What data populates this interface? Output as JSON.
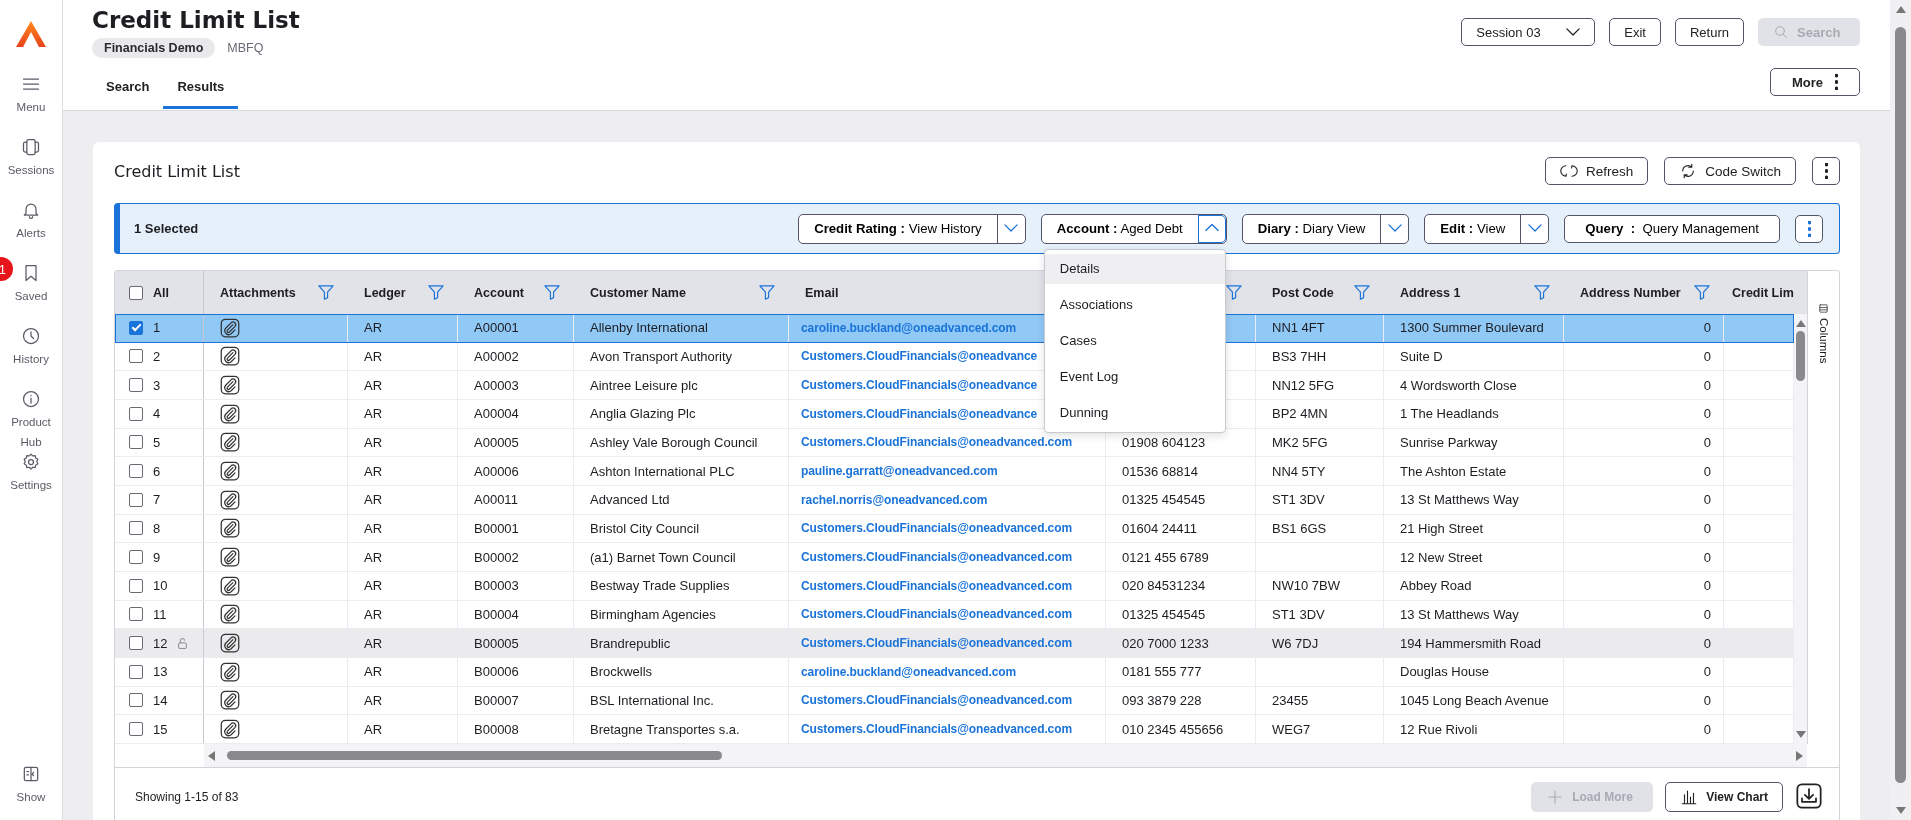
{
  "sidebar": {
    "items": [
      {
        "label": "Menu",
        "kind": "menu"
      },
      {
        "label": "Sessions",
        "kind": "sessions"
      },
      {
        "label": "Alerts",
        "kind": "alerts"
      },
      {
        "label": "Saved",
        "kind": "saved",
        "badge": "1"
      },
      {
        "label": "History",
        "kind": "history"
      },
      {
        "label": "Product Hub",
        "kind": "info"
      },
      {
        "label": "Settings",
        "kind": "settings"
      }
    ],
    "bottom": {
      "label": "Show",
      "kind": "show"
    }
  },
  "header": {
    "title": "Credit Limit List",
    "chip": "Financials Demo",
    "code": "MBFQ",
    "tabs": [
      {
        "label": "Search",
        "selected": false
      },
      {
        "label": "Results",
        "selected": true
      }
    ],
    "session": "Session 03",
    "buttons": [
      "Exit",
      "Return"
    ],
    "search": {
      "label": "Search",
      "disabled": true
    },
    "more": "More"
  },
  "card": {
    "title": "Credit Limit List",
    "actions": [
      {
        "label": "Refresh",
        "kind": "refresh"
      },
      {
        "label": "Code Switch",
        "kind": "switch"
      }
    ]
  },
  "toolbar": {
    "selection": "1 Selected",
    "actions": [
      {
        "kind": "split",
        "text": "**Credit Rating :** View History",
        "expanded": false
      },
      {
        "kind": "split",
        "text": "**Account :** Aged Debt",
        "expanded": true
      },
      {
        "kind": "split",
        "text": "**Diary :** Diary View",
        "expanded": false
      },
      {
        "kind": "split",
        "text": "**Edit :** View",
        "expanded": false
      },
      {
        "kind": "plain",
        "text": "**Query  :**  Query Management"
      }
    ],
    "menu": [
      {
        "label": "Details",
        "selected": true
      },
      {
        "label": "Associations",
        "selected": false
      },
      {
        "label": "Cases",
        "selected": false
      },
      {
        "label": "Event Log",
        "selected": false
      },
      {
        "label": "Dunning",
        "selected": false
      }
    ]
  },
  "table": {
    "all": {
      "label": "All",
      "checked": false
    },
    "columns": [
      {
        "label": "Attachments",
        "kind": "attachment",
        "filter": true
      },
      {
        "label": "Ledger",
        "kind": "text",
        "filter": true
      },
      {
        "label": "Account",
        "kind": "text",
        "filter": true
      },
      {
        "label": "Customer Name",
        "kind": "text",
        "filter": true
      },
      {
        "label": "Email",
        "kind": "link",
        "filter": false
      },
      {
        "kind": "text",
        "filter": true
      },
      {
        "label": "Post Code",
        "kind": "text",
        "filter": true
      },
      {
        "label": "Address 1",
        "kind": "text",
        "filter": true
      },
      {
        "label": "Address Number",
        "kind": "number",
        "filter": true
      },
      {
        "label": "Credit Lim",
        "kind": "text",
        "filter": false
      }
    ],
    "rows": [
      {
        "number": "1",
        "checked": true,
        "locked": false,
        "highlighted": false,
        "cells": [
          null,
          "AR",
          "A00001",
          "Allenby International",
          "caroline.buckland@oneadvanced.com",
          null,
          "NN1 4FT",
          "1300 Summer Boulevard",
          "0",
          null
        ]
      },
      {
        "number": "2",
        "checked": false,
        "locked": false,
        "highlighted": false,
        "cells": [
          null,
          "AR",
          "A00002",
          "Avon Transport Authority",
          "Customers.CloudFinancials@oneadvance",
          null,
          "BS3 7HH",
          "Suite D",
          "0",
          null
        ]
      },
      {
        "number": "3",
        "checked": false,
        "locked": false,
        "highlighted": false,
        "cells": [
          null,
          "AR",
          "A00003",
          "Aintree Leisure plc",
          "Customers.CloudFinancials@oneadvance",
          null,
          "NN12 5FG",
          "4 Wordsworth Close",
          "0",
          null
        ]
      },
      {
        "number": "4",
        "checked": false,
        "locked": false,
        "highlighted": false,
        "cells": [
          null,
          "AR",
          "A00004",
          "Anglia Glazing Plc",
          "Customers.CloudFinancials@oneadvance",
          null,
          "BP2 4MN",
          "1 The Headlands",
          "0",
          null
        ]
      },
      {
        "number": "5",
        "checked": false,
        "locked": false,
        "highlighted": false,
        "cells": [
          null,
          "AR",
          "A00005",
          "Ashley Vale Borough Council",
          "Customers.CloudFinancials@oneadvanced.com",
          "01908 604123",
          "MK2 5FG",
          "Sunrise Parkway",
          "0",
          null
        ]
      },
      {
        "number": "6",
        "checked": false,
        "locked": false,
        "highlighted": false,
        "cells": [
          null,
          "AR",
          "A00006",
          "Ashton International PLC",
          "pauline.garratt@oneadvanced.com",
          "01536 68814",
          "NN4 5TY",
          "The Ashton Estate",
          "0",
          null
        ]
      },
      {
        "number": "7",
        "checked": false,
        "locked": false,
        "highlighted": false,
        "cells": [
          null,
          "AR",
          "A00011",
          "Advanced Ltd",
          "rachel.norris@oneadvanced.com",
          "01325 454545",
          "ST1 3DV",
          "13 St Matthews Way",
          "0",
          null
        ]
      },
      {
        "number": "8",
        "checked": false,
        "locked": false,
        "highlighted": false,
        "cells": [
          null,
          "AR",
          "B00001",
          "Bristol City Council",
          "Customers.CloudFinancials@oneadvanced.com",
          "01604 24411",
          "BS1 6GS",
          "21 High Street",
          "0",
          null
        ]
      },
      {
        "number": "9",
        "checked": false,
        "locked": false,
        "highlighted": false,
        "cells": [
          null,
          "AR",
          "B00002",
          "(a1) Barnet Town Council",
          "Customers.CloudFinancials@oneadvanced.com",
          "0121 455 6789",
          null,
          "12 New Street",
          "0",
          null
        ]
      },
      {
        "number": "10",
        "checked": false,
        "locked": false,
        "highlighted": false,
        "cells": [
          null,
          "AR",
          "B00003",
          "Bestway Trade Supplies",
          "Customers.CloudFinancials@oneadvanced.com",
          "020 84531234",
          "NW10 7BW",
          "Abbey Road",
          "0",
          null
        ]
      },
      {
        "number": "11",
        "checked": false,
        "locked": false,
        "highlighted": false,
        "cells": [
          null,
          "AR",
          "B00004",
          "Birmingham Agencies",
          "Customers.CloudFinancials@oneadvanced.com",
          "01325 454545",
          "ST1 3DV",
          "13 St Matthews Way",
          "0",
          null
        ]
      },
      {
        "number": "12",
        "checked": false,
        "locked": true,
        "highlighted": true,
        "cells": [
          null,
          "AR",
          "B00005",
          "Brandrepublic",
          "Customers.CloudFinancials@oneadvanced.com",
          "020 7000 1233",
          "W6 7DJ",
          "194 Hammersmith Road",
          "0",
          null
        ]
      },
      {
        "number": "13",
        "checked": false,
        "locked": false,
        "highlighted": false,
        "cells": [
          null,
          "AR",
          "B00006",
          "Brockwells",
          "caroline.buckland@oneadvanced.com",
          "0181 555 777",
          null,
          "Douglas House",
          "0",
          null
        ]
      },
      {
        "number": "14",
        "checked": false,
        "locked": false,
        "highlighted": false,
        "cells": [
          null,
          "AR",
          "B00007",
          "BSL International Inc.",
          "Customers.CloudFinancials@oneadvanced.com",
          "093 3879 228",
          "23455",
          "1045 Long Beach Avenue",
          "0",
          null
        ]
      },
      {
        "number": "15",
        "checked": false,
        "locked": false,
        "highlighted": false,
        "cells": [
          null,
          "AR",
          "B00008",
          "Bretagne Transportes s.a.",
          "Customers.CloudFinancials@oneadvanced.com",
          "010 2345 455656",
          "WEG7",
          "12 Rue Rivoli",
          "0",
          null
        ]
      }
    ]
  },
  "columns_panel": "Columns",
  "footer": {
    "showing": "Showing 1-15 of 83",
    "load_more": {
      "label": "Load More",
      "disabled": true
    },
    "view_chart": "View Chart"
  }
}
